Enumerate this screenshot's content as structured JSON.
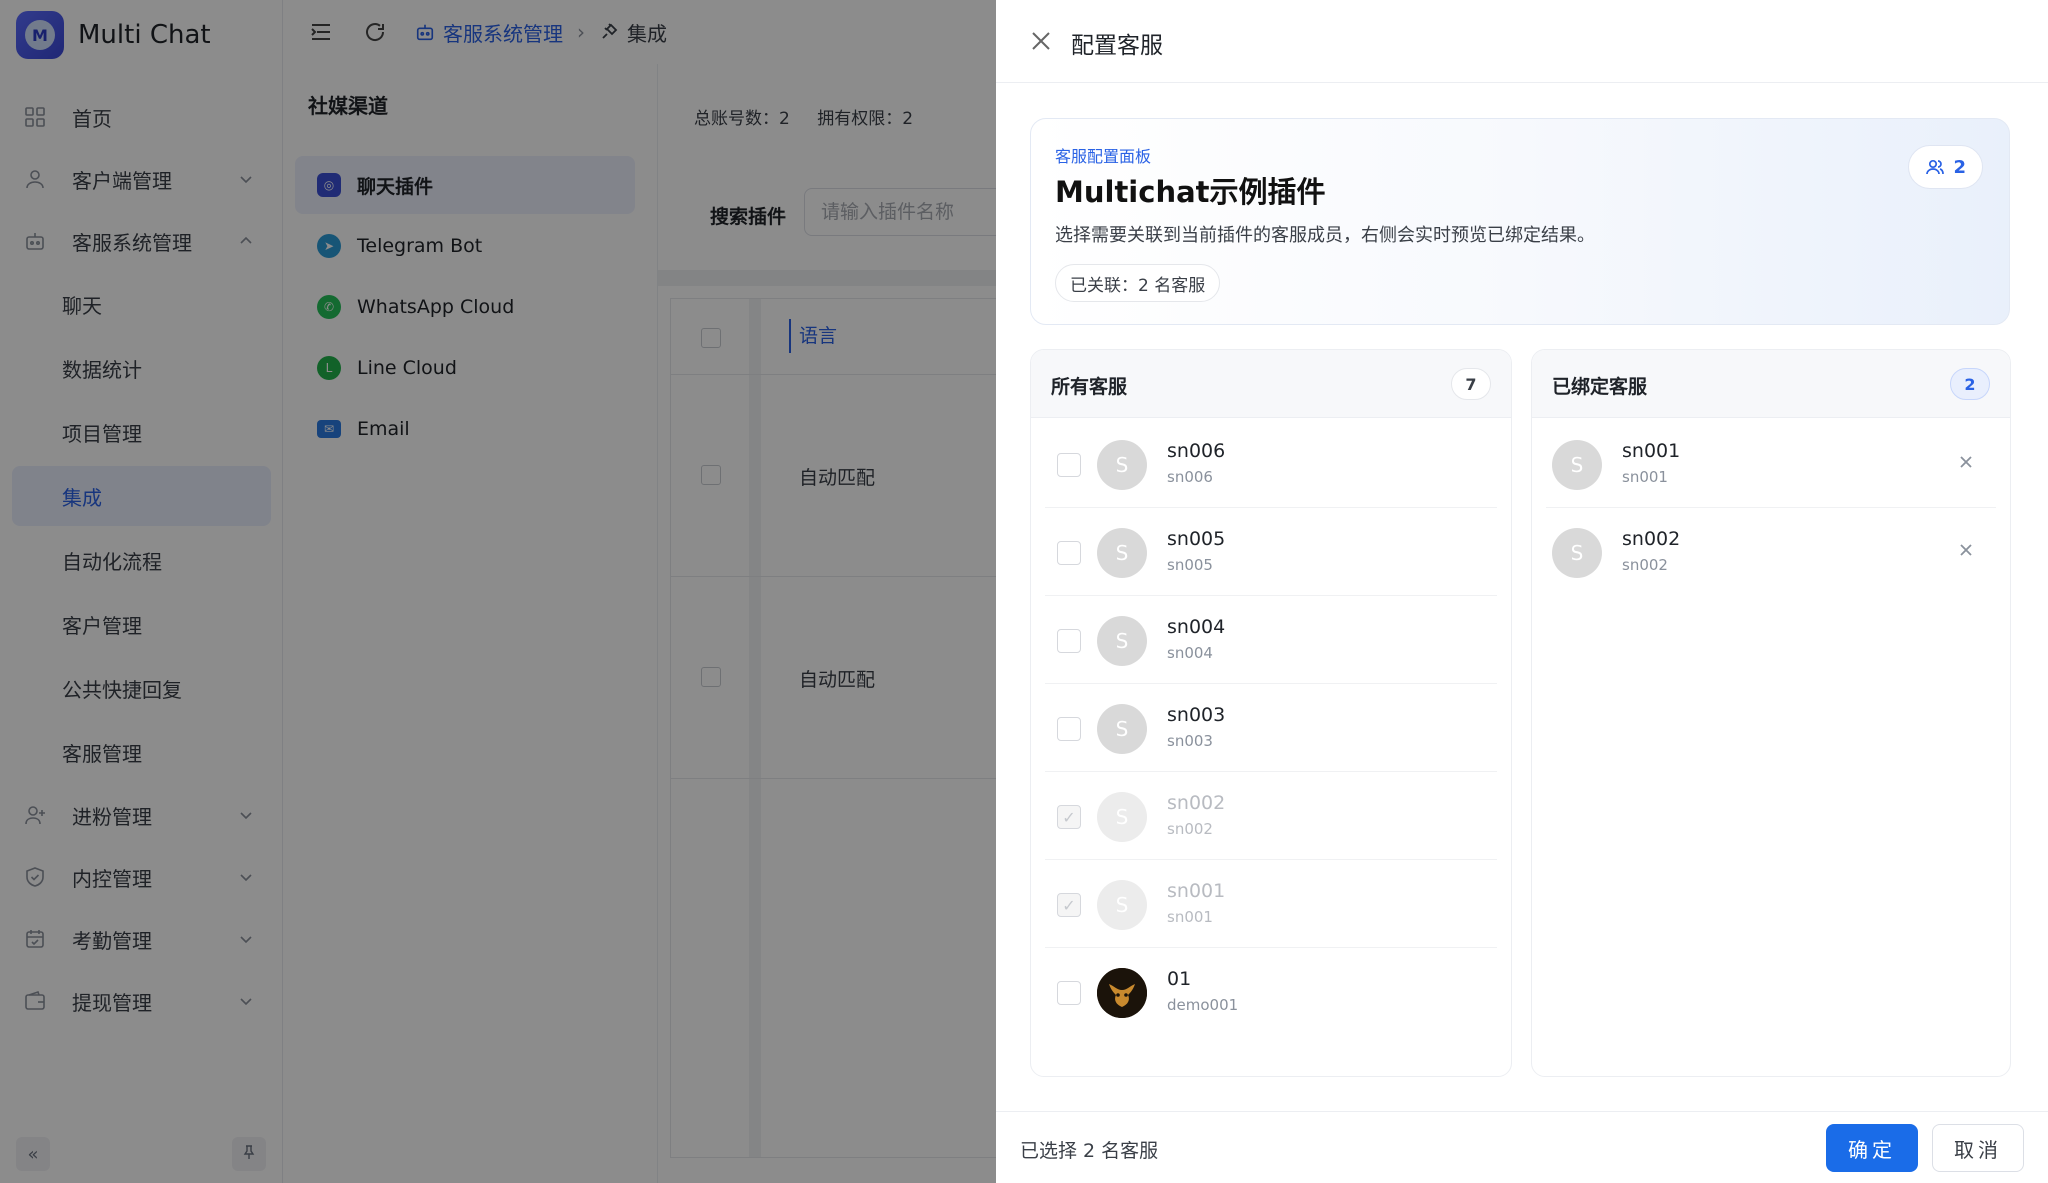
{
  "brand": {
    "name": "Multi Chat",
    "logo_letter": "M"
  },
  "sidebar": {
    "items": [
      {
        "label": "首页",
        "icon": "dashboard-icon",
        "expandable": false
      },
      {
        "label": "客户端管理",
        "icon": "user-icon",
        "expandable": true
      },
      {
        "label": "客服系统管理",
        "icon": "robot-icon",
        "expandable": true,
        "expanded": true
      }
    ],
    "sub_items": [
      "聊天",
      "数据统计",
      "项目管理",
      "集成",
      "自动化流程",
      "客户管理",
      "公共快捷回复",
      "客服管理"
    ],
    "active_sub": "集成",
    "items_after": [
      {
        "label": "进粉管理",
        "icon": "user-plus-icon"
      },
      {
        "label": "内控管理",
        "icon": "shield-icon"
      },
      {
        "label": "考勤管理",
        "icon": "calendar-icon"
      },
      {
        "label": "提现管理",
        "icon": "wallet-icon"
      }
    ]
  },
  "breadcrumb": {
    "level1": "客服系统管理",
    "level2": "集成"
  },
  "channels": {
    "title": "社媒渠道",
    "items": [
      {
        "label": "聊天插件",
        "color": "#3b4fd6",
        "active": true
      },
      {
        "label": "Telegram Bot",
        "color": "#2a9bd8",
        "active": false
      },
      {
        "label": "WhatsApp Cloud",
        "color": "#25c15a",
        "active": false
      },
      {
        "label": "Line Cloud",
        "color": "#22b34c",
        "active": false
      },
      {
        "label": "Email",
        "color": "#2a7ae2",
        "active": false
      }
    ]
  },
  "content": {
    "stats_total": "总账号数：2",
    "stats_perm": "拥有权限：2",
    "search_label": "搜索插件",
    "search_placeholder": "请输入插件名称",
    "table_header_lang": "语言",
    "rows": [
      "自动匹配",
      "自动匹配"
    ]
  },
  "drawer": {
    "title": "配置客服",
    "hero": {
      "tag": "客服配置面板",
      "title": "Multichat示例插件",
      "desc": "选择需要关联到当前插件的客服成员，右侧会实时预览已绑定结果。",
      "linked": "已关联：2 名客服",
      "count": "2"
    },
    "all_panel": {
      "title": "所有客服",
      "count": "7",
      "agents": [
        {
          "name": "sn006",
          "id": "sn006",
          "avatar": "S",
          "checked": false,
          "disabled": false
        },
        {
          "name": "sn005",
          "id": "sn005",
          "avatar": "S",
          "checked": false,
          "disabled": false
        },
        {
          "name": "sn004",
          "id": "sn004",
          "avatar": "S",
          "checked": false,
          "disabled": false
        },
        {
          "name": "sn003",
          "id": "sn003",
          "avatar": "S",
          "checked": false,
          "disabled": false
        },
        {
          "name": "sn002",
          "id": "sn002",
          "avatar": "S",
          "checked": true,
          "disabled": true
        },
        {
          "name": "sn001",
          "id": "sn001",
          "avatar": "S",
          "checked": true,
          "disabled": true
        },
        {
          "name": "01",
          "id": "demo001",
          "avatar": "",
          "checked": false,
          "disabled": false,
          "image": true
        }
      ]
    },
    "bound_panel": {
      "title": "已绑定客服",
      "count": "2",
      "agents": [
        {
          "name": "sn001",
          "id": "sn001",
          "avatar": "S"
        },
        {
          "name": "sn002",
          "id": "sn002",
          "avatar": "S"
        }
      ]
    },
    "footer": {
      "selected": "已选择 2 名客服",
      "confirm": "确定",
      "cancel": "取消"
    }
  }
}
